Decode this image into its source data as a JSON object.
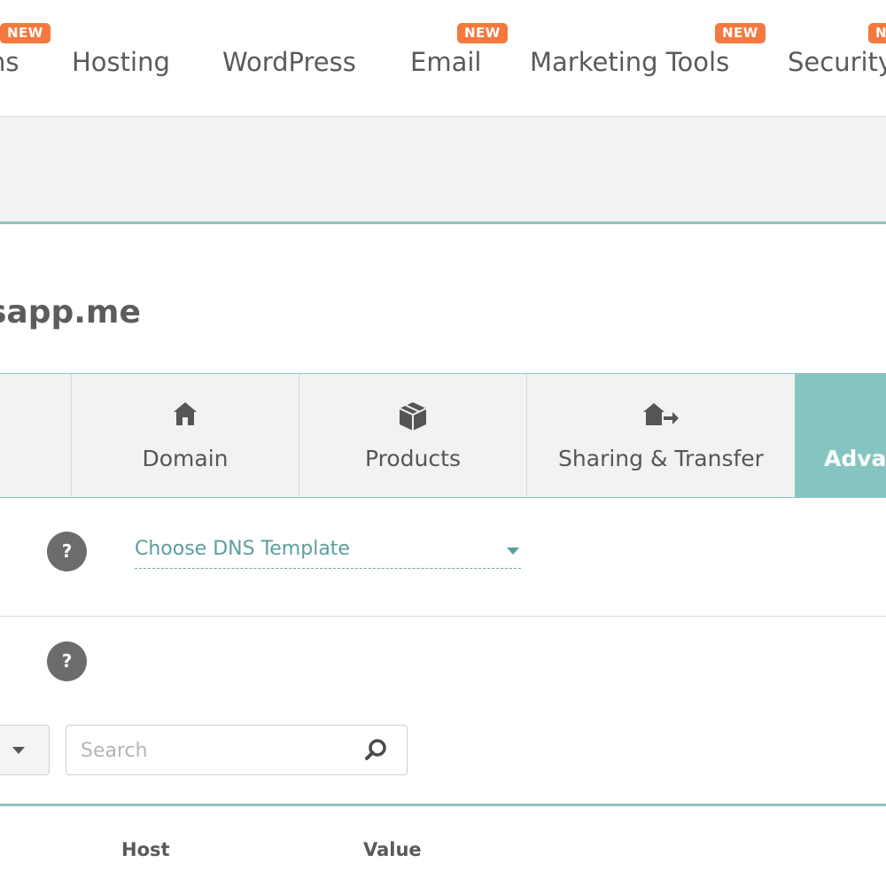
{
  "topnav": {
    "items": [
      {
        "label": "ns",
        "badge": "NEW"
      },
      {
        "label": "Hosting",
        "badge": ""
      },
      {
        "label": "WordPress",
        "badge": ""
      },
      {
        "label": "Email",
        "badge": "NEW"
      },
      {
        "label": "Marketing Tools",
        "badge": "NEW"
      },
      {
        "label": "Security",
        "badge": "NEW"
      }
    ]
  },
  "domain": {
    "title": "sapp.me"
  },
  "tabs": [
    {
      "label": "Domain",
      "icon": "home-icon"
    },
    {
      "label": "Products",
      "icon": "package-icon"
    },
    {
      "label": "Sharing & Transfer",
      "icon": "home-transfer-icon"
    },
    {
      "label": "Advan",
      "icon": "",
      "active": true
    }
  ],
  "dns": {
    "help": "?",
    "template_label": "Choose DNS Template"
  },
  "records": {
    "help": "?",
    "search_placeholder": "Search"
  },
  "table": {
    "headers": {
      "host": "Host",
      "value": "Value"
    }
  },
  "colors": {
    "accent": "#86c4c2",
    "badge": "#f5783e",
    "link": "#5d9e9c"
  }
}
